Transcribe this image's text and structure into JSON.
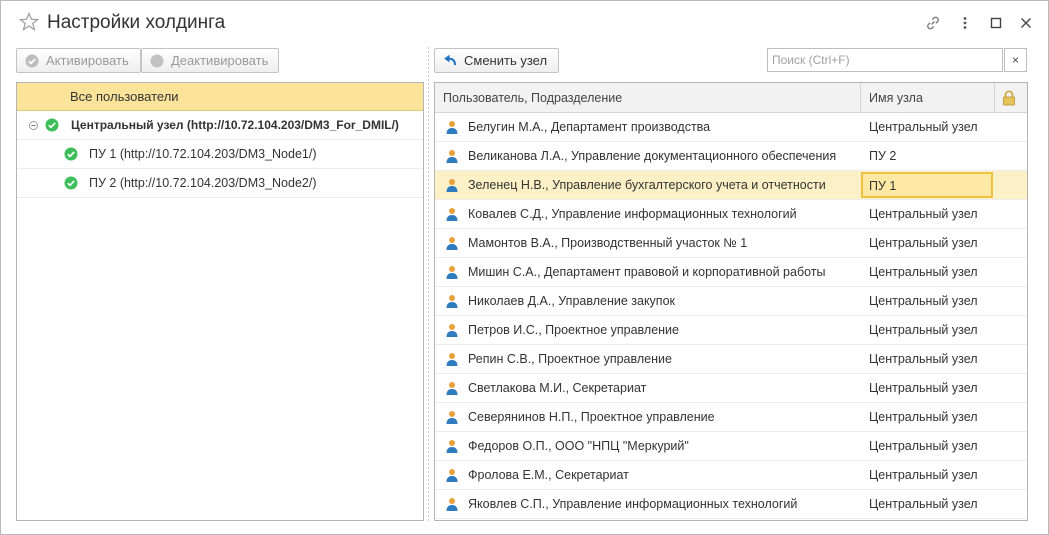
{
  "window": {
    "title": "Настройки холдинга"
  },
  "toolbar_left": {
    "activate_label": "Активировать",
    "deactivate_label": "Деактивировать"
  },
  "toolbar_right": {
    "change_node_label": "Сменить узел",
    "search_placeholder": "Поиск (Ctrl+F)",
    "search_value": "",
    "clear_symbol": "×"
  },
  "tree": {
    "header": "Все пользователи",
    "root_label": "Центральный узел (http://10.72.104.203/DM3_For_DMIL/)",
    "children": [
      {
        "label": "ПУ 1 (http://10.72.104.203/DM3_Node1/)"
      },
      {
        "label": "ПУ 2 (http://10.72.104.203/DM3_Node2/)"
      }
    ]
  },
  "grid": {
    "columns": {
      "user": "Пользователь, Подразделение",
      "node": "Имя узла",
      "lock_icon": "lock-icon"
    },
    "rows": [
      {
        "user": "Белугин М.А., Департамент производства",
        "node": "Центральный узел",
        "selected": false
      },
      {
        "user": "Великанова Л.А., Управление документационного обеспечения",
        "node": "ПУ 2",
        "selected": false
      },
      {
        "user": "Зеленец Н.В., Управление бухгалтерского учета и отчетности",
        "node": "ПУ 1",
        "selected": true
      },
      {
        "user": "Ковалев С.Д., Управление информационных технологий",
        "node": "Центральный узел",
        "selected": false
      },
      {
        "user": "Мамонтов В.А., Производственный участок № 1",
        "node": "Центральный узел",
        "selected": false
      },
      {
        "user": "Мишин С.А., Департамент правовой и корпоративной работы",
        "node": "Центральный узел",
        "selected": false
      },
      {
        "user": "Николаев Д.А., Управление закупок",
        "node": "Центральный узел",
        "selected": false
      },
      {
        "user": "Петров И.С., Проектное управление",
        "node": "Центральный узел",
        "selected": false
      },
      {
        "user": "Репин С.В., Проектное управление",
        "node": "Центральный узел",
        "selected": false
      },
      {
        "user": "Светлакова М.И., Секретариат",
        "node": "Центральный узел",
        "selected": false
      },
      {
        "user": "Северянинов Н.П., Проектное управление",
        "node": "Центральный узел",
        "selected": false
      },
      {
        "user": "Федоров О.П., ООО \"НПЦ \"Меркурий\"",
        "node": "Центральный узел",
        "selected": false
      },
      {
        "user": "Фролова Е.М., Секретариат",
        "node": "Центральный узел",
        "selected": false
      },
      {
        "user": "Яковлев С.П., Управление информационных технологий",
        "node": "Центральный узел",
        "selected": false
      }
    ]
  },
  "colors": {
    "accent_yellow": "#fbe49a",
    "selection": "#fcf1c6",
    "check_green": "#3cbf5b",
    "disabled_gray": "#bdbdbd",
    "arrow_blue": "#1f6fc4"
  }
}
